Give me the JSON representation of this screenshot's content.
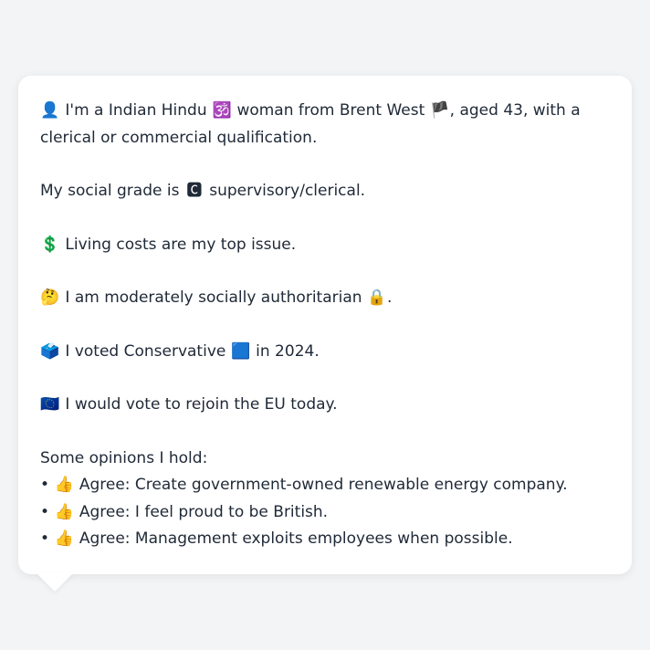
{
  "persona": {
    "intro_icon": "👤",
    "intro_text_a": "I'm a Indian Hindu",
    "religion_icon": "🕉️",
    "intro_text_b": "woman from Brent West",
    "region_flag": "🏴",
    "intro_text_c": ", aged 43, with a clerical or commercial qualification.",
    "social_text_a": "My social grade is",
    "social_icon": "🅲",
    "social_text_b": "supervisory/clerical.",
    "issue_icon": "💲",
    "issue_text": "Living costs are my top issue.",
    "values_icon": "🤔",
    "values_text": "I am moderately socially authoritarian",
    "values_end_icon": "🔒",
    "values_end": ".",
    "vote_icon": "🗳️",
    "vote_text_a": "I voted Conservative",
    "vote_party_icon": "🟦",
    "vote_text_b": "in 2024.",
    "eu_icon": "🇪🇺",
    "eu_text": "I would vote to rejoin the EU today.",
    "opinions_title": "Some opinions I hold:",
    "opinions": [
      {
        "bullet": "•",
        "icon": "👍",
        "text": "Agree: Create government-owned renewable energy company."
      },
      {
        "bullet": "•",
        "icon": "👍",
        "text": "Agree: I feel proud to be British."
      },
      {
        "bullet": "•",
        "icon": "👍",
        "text": "Agree: Management exploits employees when possible."
      }
    ]
  }
}
